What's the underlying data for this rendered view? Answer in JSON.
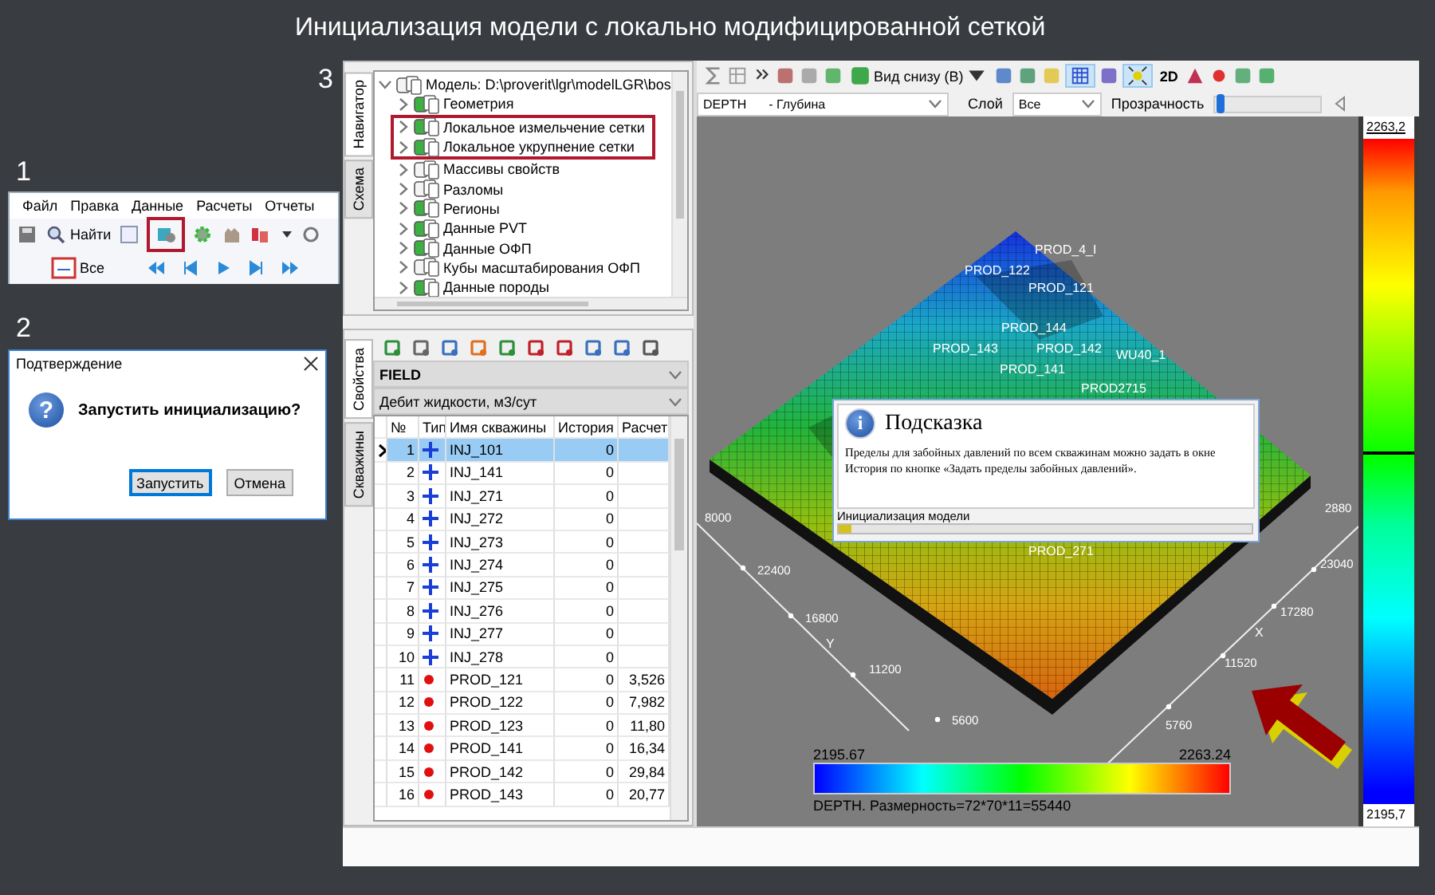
{
  "title": "Инициализация модели с локально модифицированной сеткой",
  "step_labels": [
    "1",
    "2",
    "3"
  ],
  "main_toolbar": {
    "menu": [
      "Файл",
      "Правка",
      "Данные",
      "Расчеты",
      "Отчеты"
    ],
    "find_button": "Найти",
    "period_button": "Все"
  },
  "confirm_dialog": {
    "title": "Подтверждение",
    "icon_glyph": "?",
    "message": "Запустить инициализацию?",
    "buttons": [
      {
        "label": "Запустить",
        "default": true
      },
      {
        "label": "Отмена",
        "default": false
      }
    ]
  },
  "navigator": {
    "tabs": [
      {
        "label": "Навигатор",
        "selected": true
      },
      {
        "label": "Схема",
        "selected": false
      }
    ],
    "tree": {
      "label": "Модель: D:\\proverit\\lgr\\modelLGR\\bos",
      "expanded": true,
      "children": [
        {
          "label": "Геометрия",
          "loaded": true,
          "highlighted": false
        },
        {
          "label": "Локальное измельчение сетки",
          "loaded": true,
          "highlighted": true
        },
        {
          "label": "Локальное укрупнение сетки",
          "loaded": true,
          "highlighted": true
        },
        {
          "label": "Массивы свойств",
          "loaded": false,
          "highlighted": false
        },
        {
          "label": "Разломы",
          "loaded": false,
          "highlighted": false
        },
        {
          "label": "Регионы",
          "loaded": true,
          "highlighted": false
        },
        {
          "label": "Данные PVT",
          "loaded": true,
          "highlighted": false
        },
        {
          "label": "Данные ОФП",
          "loaded": true,
          "highlighted": false
        },
        {
          "label": "Кубы масштабирования ОФП",
          "loaded": false,
          "highlighted": false
        },
        {
          "label": "Данные породы",
          "loaded": true,
          "highlighted": false
        }
      ]
    }
  },
  "wells_panel": {
    "tabs": [
      {
        "label": "Свойства",
        "selected": true
      },
      {
        "label": "Скважины",
        "selected": false
      }
    ],
    "object_select": "FIELD",
    "parameter_select": "Дебит жидкости, м3/сут",
    "columns": [
      "№",
      "Тип",
      "Имя скважины",
      "История",
      "Расчет"
    ],
    "rows": [
      {
        "no": "1",
        "kind": "injector",
        "name": "INJ_101",
        "history": "0",
        "selected": true
      },
      {
        "no": "2",
        "kind": "injector",
        "name": "INJ_141",
        "history": "0",
        "selected": false
      },
      {
        "no": "3",
        "kind": "injector",
        "name": "INJ_271",
        "history": "0",
        "selected": false
      },
      {
        "no": "4",
        "kind": "injector",
        "name": "INJ_272",
        "history": "0",
        "selected": false
      },
      {
        "no": "5",
        "kind": "injector",
        "name": "INJ_273",
        "history": "0",
        "selected": false
      },
      {
        "no": "6",
        "kind": "injector",
        "name": "INJ_274",
        "history": "0",
        "selected": false
      },
      {
        "no": "7",
        "kind": "injector",
        "name": "INJ_275",
        "history": "0",
        "selected": false
      },
      {
        "no": "8",
        "kind": "injector",
        "name": "INJ_276",
        "history": "0",
        "selected": false
      },
      {
        "no": "9",
        "kind": "injector",
        "name": "INJ_277",
        "history": "0",
        "selected": false
      },
      {
        "no": "10",
        "kind": "injector",
        "name": "INJ_278",
        "history": "0",
        "selected": false
      },
      {
        "no": "11",
        "kind": "producer",
        "name": "PROD_121",
        "history": "0",
        "calc": "3,526",
        "selected": false
      },
      {
        "no": "12",
        "kind": "producer",
        "name": "PROD_122",
        "history": "0",
        "calc": "7,982",
        "selected": false
      },
      {
        "no": "13",
        "kind": "producer",
        "name": "PROD_123",
        "history": "0",
        "calc": "11,80",
        "selected": false
      },
      {
        "no": "14",
        "kind": "producer",
        "name": "PROD_141",
        "history": "0",
        "calc": "16,34",
        "selected": false
      },
      {
        "no": "15",
        "kind": "producer",
        "name": "PROD_142",
        "history": "0",
        "calc": "29,84",
        "selected": false
      },
      {
        "no": "16",
        "kind": "producer",
        "name": "PROD_143",
        "history": "0",
        "calc": "20,77",
        "selected": false
      }
    ]
  },
  "viewer": {
    "view_button": "Вид снизу (B)",
    "mode_button": "2D",
    "property_select": "DEPTH",
    "property_desc": "- Глубина",
    "layer_label": "Слой",
    "layer_select": "Все",
    "transparency_label": "Прозрачность",
    "transparency": {
      "level": 0.02
    },
    "scale_max": "2263,2",
    "scale_min": "2195,7",
    "well_labels": [
      "PROD_4_I",
      "PROD_122",
      "PROD_121",
      "PROD_144",
      "PROD_143",
      "PROD_142",
      "PROD_141",
      "WU40_1",
      "PROD2715",
      "PROD_271"
    ],
    "y_axis": {
      "title": "Y",
      "ticks": [
        "8000",
        "22400",
        "16800",
        "11200",
        "5600"
      ]
    },
    "x_axis": {
      "title": "X",
      "ticks": [
        "5760",
        "11520",
        "17280",
        "23040",
        "2880"
      ]
    },
    "hint": {
      "icon_glyph": "i",
      "title": "Подсказка",
      "text": "Пределы для забойных давлений по всем скважинам можно задать в окне История по кнопке «Задать пределы забойных давлений».",
      "progress_label": "Инициализация модели",
      "progress": {
        "level": 0.03
      }
    },
    "legend": {
      "min": "2195.67",
      "max": "2263.24",
      "caption": "DEPTH.  Размерность=72*70*11=55440"
    }
  }
}
